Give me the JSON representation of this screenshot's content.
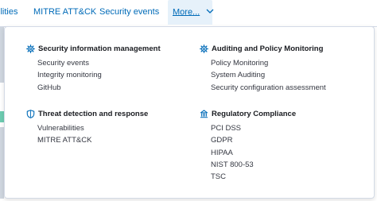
{
  "nav": {
    "tabs": [
      {
        "label": "ilities"
      },
      {
        "label": "MITRE ATT&CK"
      },
      {
        "label": "Security events"
      }
    ],
    "more_label": "More..."
  },
  "menu": {
    "groups": [
      {
        "title": "Security information management",
        "icon": "gear-icon",
        "items": [
          "Security events",
          "Integrity monitoring",
          "GitHub"
        ]
      },
      {
        "title": "Auditing and Policy Monitoring",
        "icon": "gear-icon",
        "items": [
          "Policy Monitoring",
          "System Auditing",
          "Security configuration assessment"
        ]
      },
      {
        "title": "Threat detection and response",
        "icon": "shield-icon",
        "items": [
          "Vulnerabilities",
          "MITRE ATT&CK"
        ]
      },
      {
        "title": "Regulatory Compliance",
        "icon": "building-icon",
        "items": [
          "PCI DSS",
          "GDPR",
          "HIPAA",
          "NIST 800-53",
          "TSC"
        ]
      }
    ]
  },
  "colors": {
    "link": "#006bb8",
    "icon": "#006bb8",
    "title_text": "#1a1c21",
    "item_text": "#343741",
    "more_tab_bg": "#e6f1fa",
    "side_accent": "#6dccb1"
  }
}
